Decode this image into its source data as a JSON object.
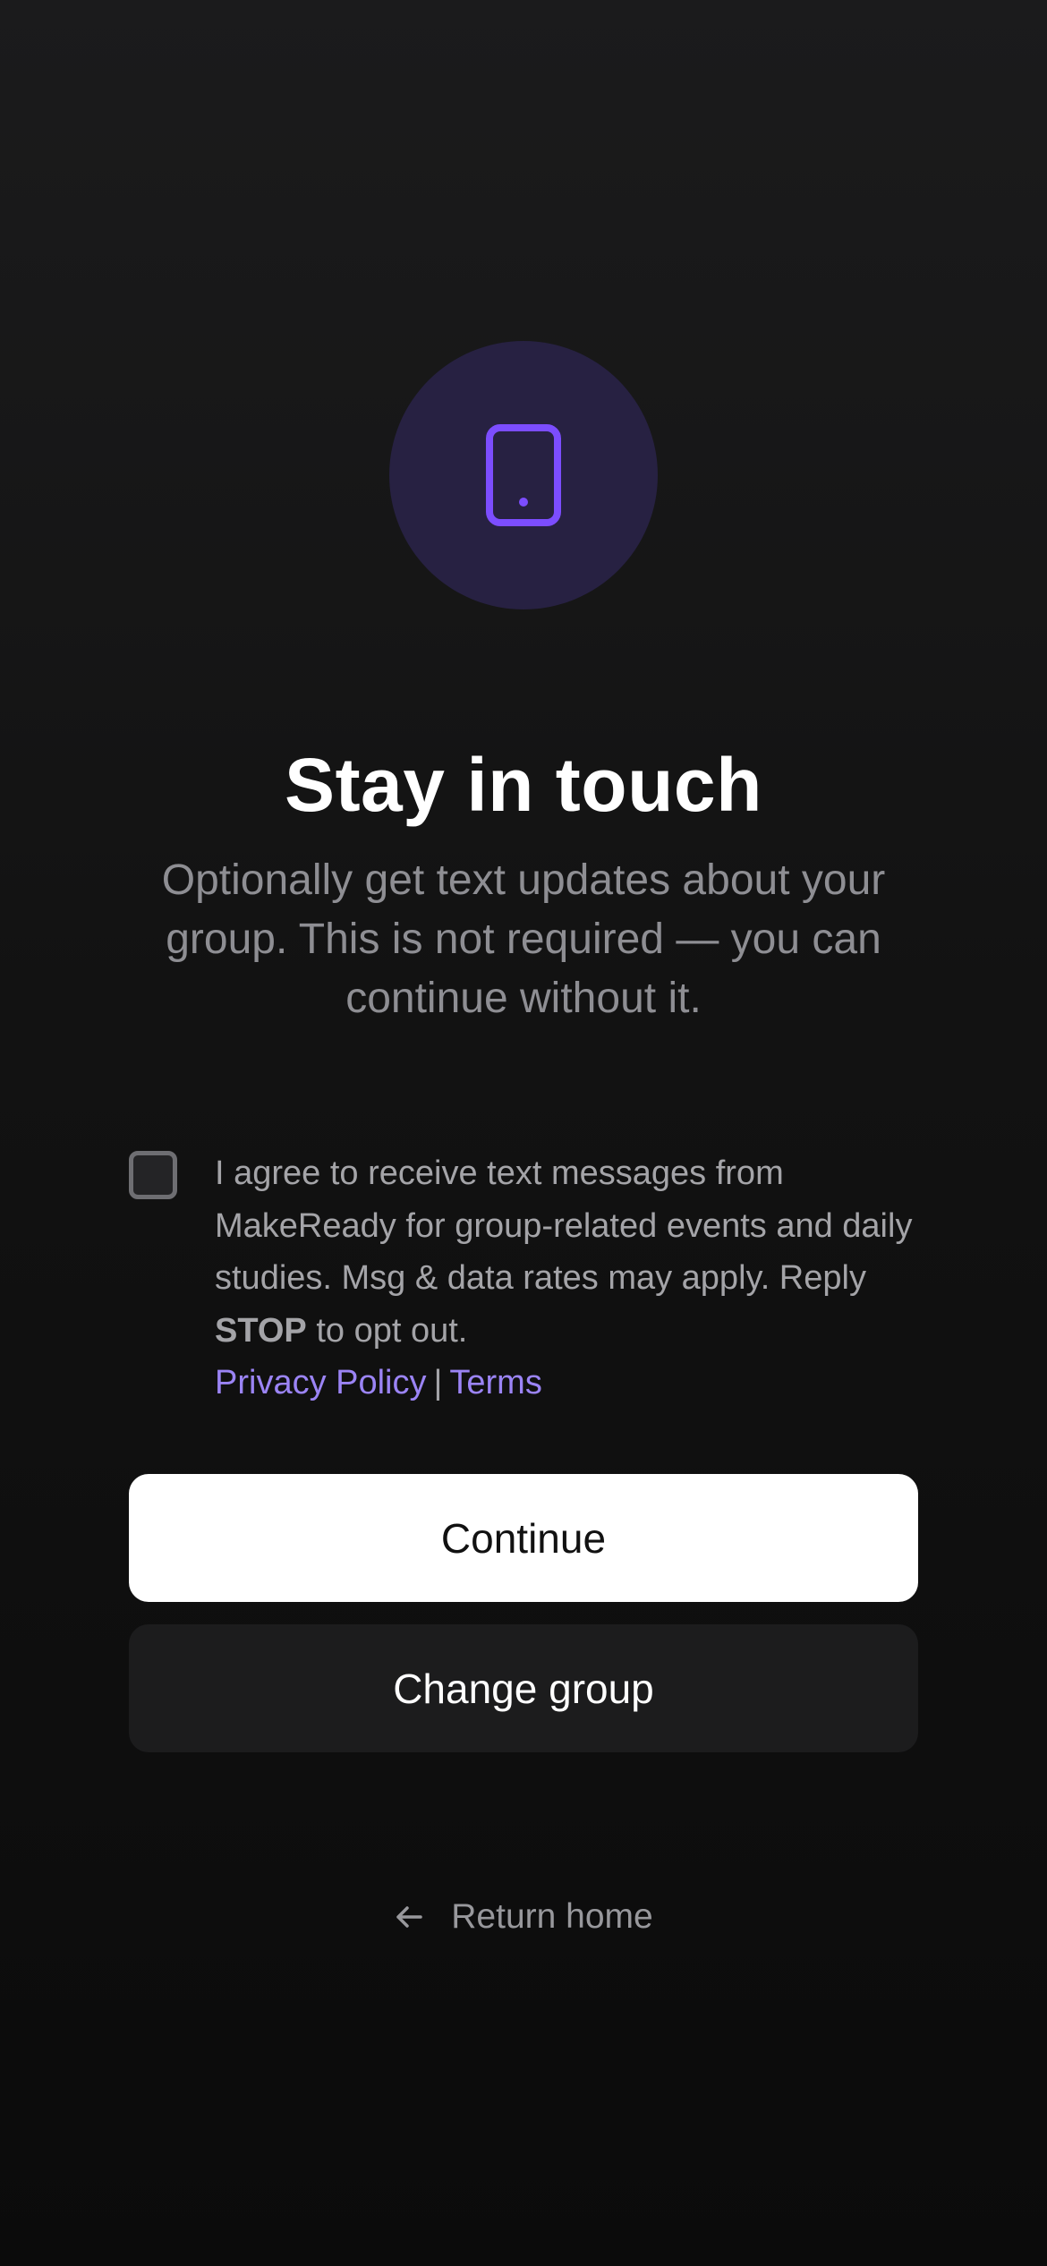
{
  "hero": {
    "icon": "smartphone-icon",
    "title": "Stay in touch",
    "subtitle": "Optionally get text updates about your group. This is not required — you can continue without it."
  },
  "consent": {
    "checked": false,
    "text_before": "I agree to receive text messages from MakeReady for group-related events and daily studies. Msg & data rates may apply. Reply ",
    "keyword": "STOP",
    "text_after": " to opt out.",
    "privacy_link": "Privacy Policy",
    "separator": "|",
    "terms_link": "Terms"
  },
  "actions": {
    "continue_label": "Continue",
    "change_group_label": "Change group",
    "return_home_label": "Return home"
  },
  "colors": {
    "accent": "#7c4dff",
    "link": "#9b84f5",
    "icon_circle_bg": "#272142"
  }
}
